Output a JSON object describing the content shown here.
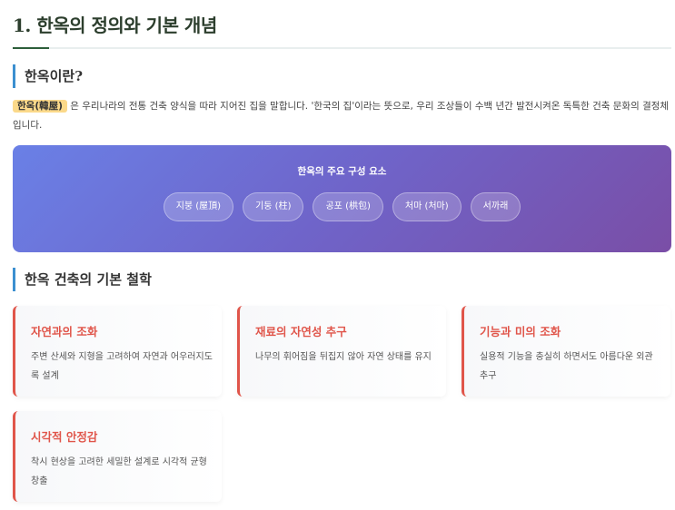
{
  "page": {
    "title": "1. 한옥의 정의와 기본 개념"
  },
  "section1": {
    "heading": "한옥이란?",
    "highlight": "한옥(韓屋)",
    "body": " 은 우리나라의 전통 건축 양식을 따라 지어진 집을 말합니다. '한국의 집'이라는 뜻으로, 우리 조상들이 수백 년간 발전시켜온 독특한 건축 문화의 결정체입니다."
  },
  "banner": {
    "title": "한옥의 주요 구성 요소",
    "chips": [
      "지붕 (屋頂)",
      "기둥 (柱)",
      "공포 (栱包)",
      "처마 (처마)",
      "서까래"
    ]
  },
  "section2": {
    "heading": "한옥 건축의 기본 철학",
    "cards": [
      {
        "title": "자연과의 조화",
        "desc": "주변 산세와 지형을 고려하여 자연과 어우러지도록 설계"
      },
      {
        "title": "재료의 자연성 추구",
        "desc": "나무의 휘어짐을 뒤집지 않아 자연 상태를 유지"
      },
      {
        "title": "기능과 미의 조화",
        "desc": "실용적 기능을 충실히 하면서도 아름다운 외관 추구"
      },
      {
        "title": "시각적 안정감",
        "desc": "착시 현상을 고려한 세밀한 설계로 시각적 균형 창출"
      }
    ]
  },
  "colors": {
    "title_accent": "#2c5e3a",
    "section_bar": "#3b8fd0",
    "card_accent": "#e0554a",
    "highlight_bg": "#fbd98a",
    "banner_gradient_start": "#6a80e6",
    "banner_gradient_end": "#7a4ea6"
  }
}
